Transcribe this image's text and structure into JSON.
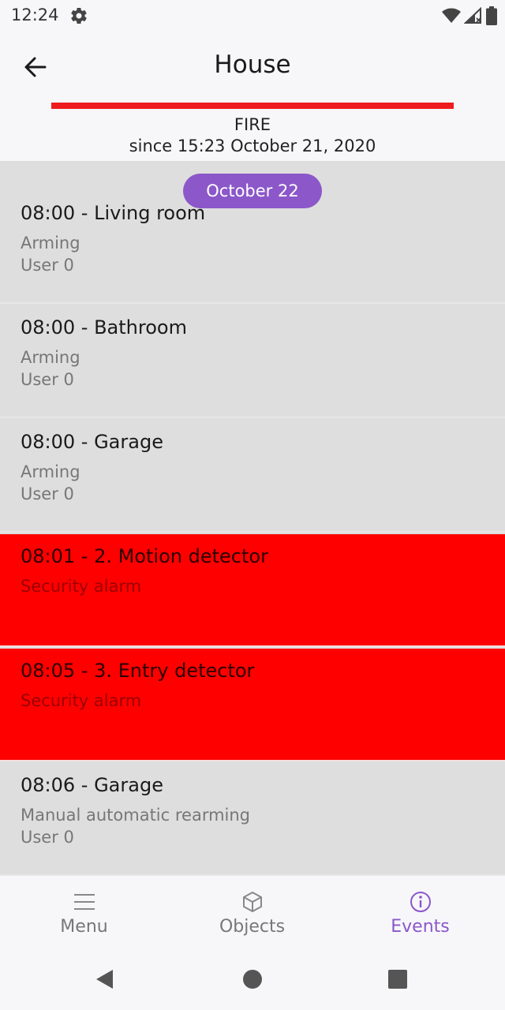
{
  "status_bar": {
    "time": "12:24"
  },
  "app_bar": {
    "title": "House"
  },
  "alarm": {
    "status": "FIRE",
    "since": "since 15:23 October 21, 2020",
    "color": "#ee1c1c"
  },
  "date_chip": "October 22",
  "events": [
    {
      "title": "08:00 - Living room",
      "line1": "Arming",
      "line2": "User 0",
      "alarm": false
    },
    {
      "title": "08:00 - Bathroom",
      "line1": "Arming",
      "line2": "User 0",
      "alarm": false
    },
    {
      "title": "08:00 - Garage",
      "line1": "Arming",
      "line2": "User 0",
      "alarm": false
    },
    {
      "title": "08:01 - 2. Motion detector",
      "line1": "Security alarm",
      "line2": "",
      "alarm": true
    },
    {
      "title": "08:05 - 3. Entry detector",
      "line1": "Security alarm",
      "line2": "",
      "alarm": true
    },
    {
      "title": "08:06 - Garage",
      "line1": "Manual automatic rearming",
      "line2": "User 0",
      "alarm": false
    }
  ],
  "bottom_nav": {
    "items": [
      {
        "label": "Menu",
        "icon": "menu-icon",
        "active": false
      },
      {
        "label": "Objects",
        "icon": "cube-icon",
        "active": false
      },
      {
        "label": "Events",
        "icon": "info-icon",
        "active": true
      }
    ]
  },
  "colors": {
    "accent": "#8b57c9",
    "alarm_row": "#ff0000",
    "list_bg": "#dedede"
  }
}
